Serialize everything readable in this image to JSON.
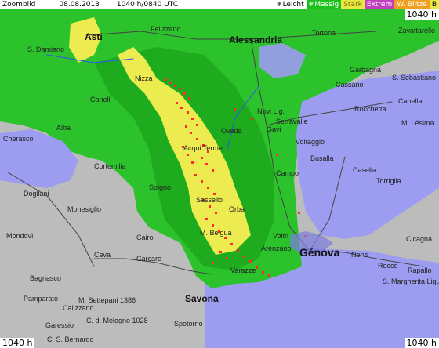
{
  "header": {
    "title": "Zoombild",
    "date": "08.08.2013",
    "time": "1040 h/0840 UTC"
  },
  "legend": [
    {
      "label": "Leicht",
      "color": "#1cc11c",
      "text_color": "#000000",
      "icon": "snowflake-icon"
    },
    {
      "label": "Massig",
      "color": "#e8e845",
      "text_color": "#ffffff",
      "icon": "snowflake-icon"
    },
    {
      "label": "Stark",
      "color": "#e8e845",
      "text_color": "#7a6a00"
    },
    {
      "label": "Extrem",
      "color": "#c040c0",
      "text_color": "#ffffff"
    },
    {
      "label": "W. Blitze",
      "color": "#f0a020",
      "text_color": "#ffffff"
    },
    {
      "label": "B",
      "color": "#e8e845",
      "text_color": "#000000"
    }
  ],
  "corner_labels": {
    "top_right": "1040 h",
    "bottom_left": "1040 h",
    "bottom_right": "1040 h"
  },
  "places": [
    {
      "name": "Asti",
      "kind": "city"
    },
    {
      "name": "Alessandria",
      "kind": "city"
    },
    {
      "name": "Tortona",
      "kind": "town"
    },
    {
      "name": "Zavattarello",
      "kind": "town"
    },
    {
      "name": "S. Damiano",
      "kind": "town"
    },
    {
      "name": "Felizzano",
      "kind": "town"
    },
    {
      "name": "Nizza",
      "kind": "town"
    },
    {
      "name": "Canelli",
      "kind": "town"
    },
    {
      "name": "Novi Lig.",
      "kind": "town"
    },
    {
      "name": "Cassano",
      "kind": "town"
    },
    {
      "name": "Serravalle",
      "kind": "town"
    },
    {
      "name": "Gavi",
      "kind": "town"
    },
    {
      "name": "Ovada",
      "kind": "town"
    },
    {
      "name": "Alba",
      "kind": "town"
    },
    {
      "name": "Cherasco",
      "kind": "town"
    },
    {
      "name": "Cortemilia",
      "kind": "town"
    },
    {
      "name": "Spigno",
      "kind": "town"
    },
    {
      "name": "Dogliani",
      "kind": "town"
    },
    {
      "name": "Monesiglio",
      "kind": "town"
    },
    {
      "name": "Ceva",
      "kind": "town"
    },
    {
      "name": "Mondovì",
      "kind": "town"
    },
    {
      "name": "Bagnasco",
      "kind": "town"
    },
    {
      "name": "Calizzano",
      "kind": "town"
    },
    {
      "name": "Garessio",
      "kind": "town"
    },
    {
      "name": "Pamparato",
      "kind": "town"
    },
    {
      "name": "C. S. Bernardo",
      "kind": "town"
    },
    {
      "name": "Savona",
      "kind": "city"
    },
    {
      "name": "Spotorno",
      "kind": "town"
    },
    {
      "name": "Varazze",
      "kind": "town"
    },
    {
      "name": "Arenzano",
      "kind": "town"
    },
    {
      "name": "Voltri",
      "kind": "town"
    },
    {
      "name": "Génova",
      "kind": "bigcity"
    },
    {
      "name": "Nervi",
      "kind": "town"
    },
    {
      "name": "Recco",
      "kind": "town"
    },
    {
      "name": "S. Margherita Ligure",
      "kind": "town"
    },
    {
      "name": "Cicagna",
      "kind": "town"
    },
    {
      "name": "Rapallo",
      "kind": "town"
    },
    {
      "name": "Busalla",
      "kind": "town"
    },
    {
      "name": "Casella",
      "kind": "town"
    },
    {
      "name": "Torriglia",
      "kind": "town"
    },
    {
      "name": "Rocchetta",
      "kind": "town"
    },
    {
      "name": "Garbagna",
      "kind": "town"
    },
    {
      "name": "S. Sebastiano",
      "kind": "town"
    },
    {
      "name": "Cabella",
      "kind": "town"
    },
    {
      "name": "M. Lésima",
      "kind": "town"
    },
    {
      "name": "Voltaggio",
      "kind": "town"
    },
    {
      "name": "Campo",
      "kind": "town"
    },
    {
      "name": "Orba",
      "kind": "town"
    },
    {
      "name": "Cairo",
      "kind": "town"
    },
    {
      "name": "Carcare",
      "kind": "town"
    },
    {
      "name": "Sassello",
      "kind": "town"
    },
    {
      "name": "Acqui Terme",
      "kind": "town"
    },
    {
      "name": "M. Settepani 1386",
      "kind": "town"
    },
    {
      "name": "C. d. Melogno 1028",
      "kind": "town"
    },
    {
      "name": "M. Beigua",
      "kind": "town"
    }
  ],
  "colors": {
    "green": "#2cc22c",
    "dark_green": "#149914",
    "yellow": "#ecec50",
    "blue": "#9c9cf0",
    "red": "#ff2a2a",
    "terrain": "#b8b8b8"
  }
}
